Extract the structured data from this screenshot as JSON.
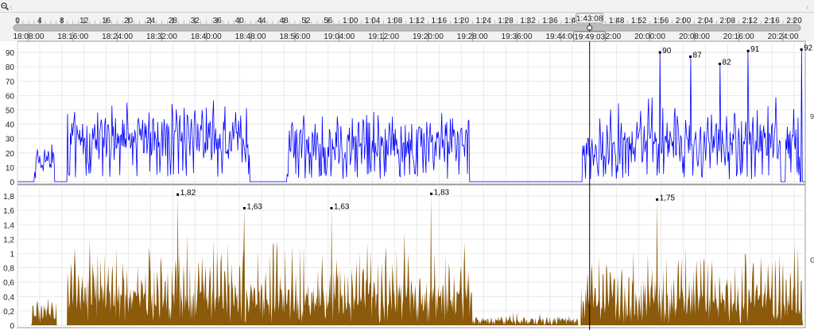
{
  "toolbar": {
    "zoom_icon": "magnifier-icon",
    "scroll_left_icon": "chevron-left-icon",
    "scroll_right_icon": "chevron-right-icon"
  },
  "elapsed_ruler": {
    "labels": [
      "0",
      "4",
      "8",
      "12",
      "16",
      "20",
      "24",
      "28",
      "32",
      "36",
      "40",
      "44",
      "48",
      "52",
      "56",
      "1:00",
      "1:04",
      "1:08",
      "1:12",
      "1:16",
      "1:20",
      "1:24",
      "1:28",
      "1:32",
      "1:36",
      "1:40",
      "1:44",
      "1:48",
      "1:52",
      "1:56",
      "2:00",
      "2:04",
      "2:08",
      "2:12",
      "2:16",
      "2:20"
    ],
    "cursor_label": "1:43:08",
    "cursor_minutes": 103.13,
    "max_minutes": 142
  },
  "clock_ruler": {
    "labels": [
      "18:08:00",
      "18:16:00",
      "18:24:00",
      "18:32:00",
      "18:40:00",
      "18:48:00",
      "18:56:00",
      "19:04:00",
      "19:12:00",
      "19:20:00",
      "19:28:00",
      "19:36:00",
      "19:44:00",
      "19:52:00",
      "20:00:00",
      "20:08:00",
      "20:16:00",
      "20:24:00"
    ],
    "cursor_label": "19:49:03"
  },
  "colors": {
    "speed": "#0000ff",
    "power": "#8b5a0a",
    "cursor": "#000000",
    "grid": "#e4e4e4",
    "ruler_bg": "#f2f2f2",
    "slider_bar": "#bdbdbd"
  },
  "chart_data": [
    {
      "type": "line",
      "series": [
        {
          "color": "#0000ff"
        }
      ],
      "ylim": [
        0,
        95
      ],
      "y_ticks": [
        "0",
        "10",
        "20",
        "30",
        "40",
        "50",
        "60",
        "70",
        "80",
        "90"
      ],
      "right_label": "9",
      "x_unit": "minutes elapsed",
      "segments": [
        {
          "start": 3.0,
          "end": 6.6,
          "base": 18,
          "amp": 8
        },
        {
          "start": 9.0,
          "end": 41.8,
          "base": 32,
          "amp": 22
        },
        {
          "start": 48.5,
          "end": 81.5,
          "base": 30,
          "amp": 20
        },
        {
          "start": 101.8,
          "end": 104.6,
          "base": 22,
          "amp": 14
        },
        {
          "start": 104.6,
          "end": 137.5,
          "base": 26,
          "amp": 32
        },
        {
          "start": 138.5,
          "end": 141.0,
          "base": 30,
          "amp": 25
        }
      ],
      "annotations": [
        {
          "x": 115.8,
          "y": 90,
          "label": "90"
        },
        {
          "x": 121.3,
          "y": 87,
          "label": "87"
        },
        {
          "x": 126.6,
          "y": 82,
          "label": "82"
        },
        {
          "x": 131.7,
          "y": 91,
          "label": "91"
        },
        {
          "x": 141.3,
          "y": 92,
          "label": "92"
        }
      ]
    },
    {
      "type": "area",
      "series": [
        {
          "color": "#8b5a0a"
        }
      ],
      "ylim": [
        0,
        1.9
      ],
      "y_ticks": [
        "0",
        "0,2",
        "0,4",
        "0,6",
        "0,8",
        "1",
        "1,2",
        "1,4",
        "1,6",
        "1,8"
      ],
      "right_label": "G",
      "x_unit": "minutes elapsed",
      "segments": [
        {
          "start": 2.5,
          "end": 7.0,
          "base": 0.18,
          "amp": 0.22
        },
        {
          "start": 9.0,
          "end": 82.0,
          "base": 0.35,
          "amp": 0.9
        },
        {
          "start": 82.0,
          "end": 101.0,
          "base": 0.06,
          "amp": 0.12
        },
        {
          "start": 101.5,
          "end": 141.5,
          "base": 0.3,
          "amp": 0.85
        }
      ],
      "annotations": [
        {
          "x": 28.9,
          "y": 1.82,
          "label": "1,82"
        },
        {
          "x": 40.9,
          "y": 1.63,
          "label": "1,63"
        },
        {
          "x": 56.6,
          "y": 1.63,
          "label": "1,63"
        },
        {
          "x": 74.6,
          "y": 1.83,
          "label": "1,83"
        },
        {
          "x": 115.3,
          "y": 1.75,
          "label": "1,75"
        }
      ]
    }
  ]
}
